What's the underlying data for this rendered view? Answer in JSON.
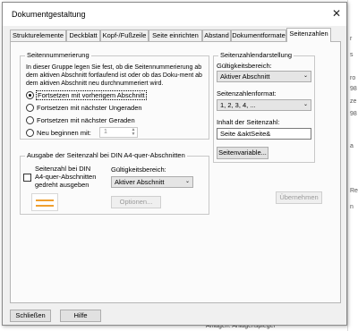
{
  "background": {
    "right_fragments": [
      "r",
      "s",
      "ro",
      "98",
      "ze",
      "98",
      "a",
      "Re",
      "n"
    ],
    "bottom_text": "Anlagen: Anlagenspiegel"
  },
  "dialog": {
    "title": "Dokumentgestaltung",
    "close_label": "✕"
  },
  "tabs": [
    {
      "label": "Strukturelemente"
    },
    {
      "label": "Deckblatt"
    },
    {
      "label": "Kopf-/Fußzeile"
    },
    {
      "label": "Seite einrichten"
    },
    {
      "label": "Abstand"
    },
    {
      "label": "Dokumentformate"
    },
    {
      "label": "Seitenzahlen",
      "active": true
    }
  ],
  "numbering": {
    "group_title": "Seitennummerierung",
    "description": "In dieser Gruppe legen Sie fest, ob die Seitennummerierung ab dem aktiven Abschnitt fortlaufend ist oder ob das Doku-ment ab dem aktiven Abschnitt neu durchnummeriert wird.",
    "options": [
      {
        "label": "Fortsetzen mit vorherigem Abschnitt",
        "selected": true
      },
      {
        "label": "Fortsetzen mit nächster Ungeraden",
        "selected": false
      },
      {
        "label": "Fortsetzen mit nächster Geraden",
        "selected": false
      },
      {
        "label": "Neu beginnen mit:",
        "selected": false
      }
    ],
    "start_value": "1"
  },
  "a4": {
    "group_title": "Ausgabe der Seitenzahl bei DIN A4-quer-Abschnitten",
    "checkbox_label_lines": [
      "Seitenzahl bei DIN",
      "A4-quer-Abschnitten",
      "gedreht ausgeben"
    ],
    "checked": false,
    "scope_label": "Gültigkeitsbereich:",
    "scope_value": "Aktiver Abschnitt",
    "options_button": "Optionen..."
  },
  "display": {
    "group_title": "Seitenzahlendarstellung",
    "scope_label": "Gültigkeitsbereich:",
    "scope_value": "Aktiver Abschnitt",
    "format_label": "Seitenzahlenformat:",
    "format_value": "1, 2, 3, 4, ...",
    "content_label": "Inhalt der Seitenzahl:",
    "content_value": "Seite &aktSeite&",
    "variables_button": "Seitenvariable..."
  },
  "apply_button": "Übernehmen",
  "footer": {
    "close_button": "Schließen",
    "help_button": "Hilfe"
  }
}
